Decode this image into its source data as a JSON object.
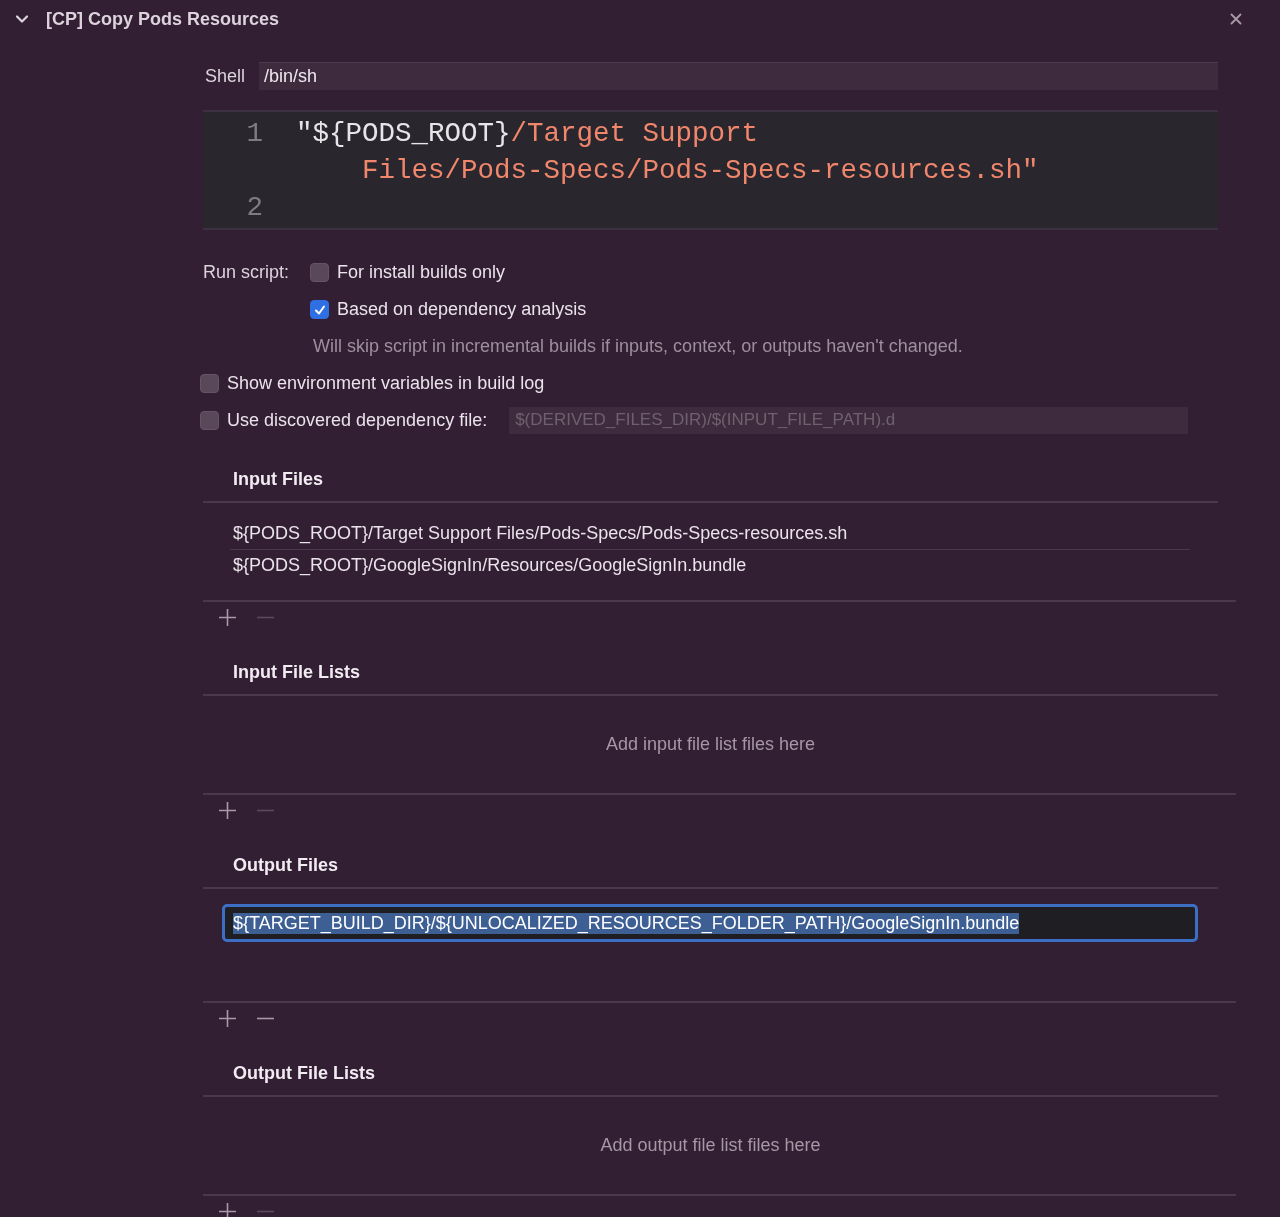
{
  "phase": {
    "title": "[CP] Copy Pods Resources",
    "expanded": true
  },
  "shell": {
    "label": "Shell",
    "value": "/bin/sh"
  },
  "script": {
    "lines": [
      {
        "number": "1",
        "segments": [
          {
            "kind": "plain",
            "text": "\"${PODS_ROOT}"
          },
          {
            "kind": "string",
            "text": "/Target Support Files/Pods-Specs/Pods-Specs-resources.sh\""
          }
        ]
      },
      {
        "number": "2"
      }
    ]
  },
  "run_script": {
    "label": "Run script:",
    "options": [
      {
        "label": "For install builds only",
        "checked": false
      },
      {
        "label": "Based on dependency analysis",
        "checked": true
      }
    ],
    "note": "Will skip script in incremental builds if inputs, context, or outputs haven't changed."
  },
  "settings": [
    {
      "kind": "checkbox",
      "label": "Show environment variables in build log",
      "checked": false
    },
    {
      "kind": "field",
      "label": "Use discovered dependency file:",
      "checked": false,
      "placeholder": "$(DERIVED_FILES_DIR)/$(INPUT_FILE_PATH).d"
    }
  ],
  "sections": [
    {
      "title": "Input Files",
      "remove_enabled": false,
      "items": [
        {
          "path": "${PODS_ROOT}/Target Support Files/Pods-Specs/Pods-Specs-resources.sh",
          "selected": false
        },
        {
          "path": "${PODS_ROOT}/GoogleSignIn/Resources/GoogleSignIn.bundle",
          "selected": false
        }
      ]
    },
    {
      "title": "Input File Lists",
      "remove_enabled": false,
      "placeholder": "Add input file list files here"
    },
    {
      "title": "Output Files",
      "remove_enabled": true,
      "items": [
        {
          "path": "${TARGET_BUILD_DIR}/${UNLOCALIZED_RESOURCES_FOLDER_PATH}/GoogleSignIn.bundle",
          "selected": true
        }
      ]
    },
    {
      "title": "Output File Lists",
      "remove_enabled": false,
      "placeholder": "Add output file list files here"
    }
  ]
}
